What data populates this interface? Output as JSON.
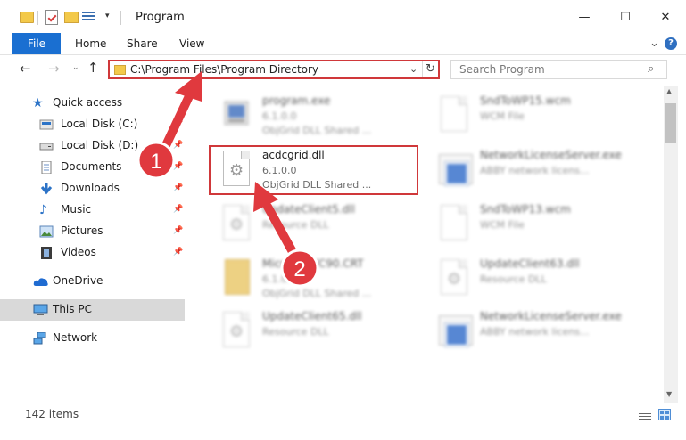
{
  "window": {
    "title": "Program",
    "minimize": "—",
    "maximize": "☐",
    "close": "✕"
  },
  "ribbon": {
    "tabs": [
      "File",
      "Home",
      "Share",
      "View"
    ],
    "expand": "⌄",
    "help": "?"
  },
  "nav": {
    "back": "←",
    "forward": "→",
    "recent": "⌄",
    "up": "↑",
    "address": "C:\\Program Files\\Program Directory",
    "address_dropdown": "⌄",
    "refresh": "↻",
    "search_placeholder": "Search Program",
    "search_icon": "⌕"
  },
  "sidebar": {
    "items": [
      {
        "label": "Quick access",
        "icon": "star-icon"
      },
      {
        "label": "Local Disk (C:)",
        "icon": "drive-icon",
        "pinned": true
      },
      {
        "label": "Local Disk (D:)",
        "icon": "drive-icon",
        "pinned": true
      },
      {
        "label": "Documents",
        "icon": "documents-icon",
        "pinned": true
      },
      {
        "label": "Downloads",
        "icon": "download-icon",
        "pinned": true
      },
      {
        "label": "Music",
        "icon": "music-icon",
        "pinned": true
      },
      {
        "label": "Pictures",
        "icon": "pictures-icon",
        "pinned": true
      },
      {
        "label": "Videos",
        "icon": "videos-icon",
        "pinned": true
      },
      {
        "label": "OneDrive",
        "icon": "cloud-icon"
      },
      {
        "label": "This PC",
        "icon": "computer-icon",
        "selected": true
      },
      {
        "label": "Network",
        "icon": "network-icon"
      }
    ],
    "pin_glyph": "📌"
  },
  "files": [
    {
      "name": "program.exe",
      "type": "6.1.0.0",
      "desc": "ObjGrid DLL Shared ...",
      "icon": "exe-icon",
      "blurred": true
    },
    {
      "name": "SndToWP15.wcm",
      "type": "WCM File",
      "desc": "",
      "icon": "document-icon",
      "blurred": true
    },
    {
      "name": "acdcgrid.dll",
      "type": "6.1.0.0",
      "desc": "ObjGrid DLL Shared ...",
      "icon": "dll-gear-icon",
      "blurred": false
    },
    {
      "name": "NetworkLicenseServer.exe",
      "type": "ABBY network licens...",
      "desc": "",
      "icon": "exe-icon",
      "blurred": true
    },
    {
      "name": "UpdateClient5.dll",
      "type": "Resource DLL",
      "desc": "",
      "icon": "dll-gear-icon",
      "blurred": true
    },
    {
      "name": "SndToWP13.wcm",
      "type": "WCM File",
      "desc": "",
      "icon": "document-icon",
      "blurred": true
    },
    {
      "name": "MicrosoftVC90.CRT",
      "type": "6.1.0.0",
      "desc": "ObjGrid DLL Shared ...",
      "icon": "folder-icon",
      "blurred": true
    },
    {
      "name": "UpdateClient63.dll",
      "type": "Resource DLL",
      "desc": "",
      "icon": "dll-gear-icon",
      "blurred": true
    },
    {
      "name": "UpdateClient65.dll",
      "type": "Resource DLL",
      "desc": "",
      "icon": "dll-gear-icon",
      "blurred": true
    },
    {
      "name": "NetworkLicenseServer.exe",
      "type": "ABBY network licens...",
      "desc": "",
      "icon": "exe-icon",
      "blurred": true
    }
  ],
  "annotations": {
    "badge1": "1",
    "badge2": "2",
    "color": "#e0393e"
  },
  "status": {
    "items": "142 items"
  }
}
